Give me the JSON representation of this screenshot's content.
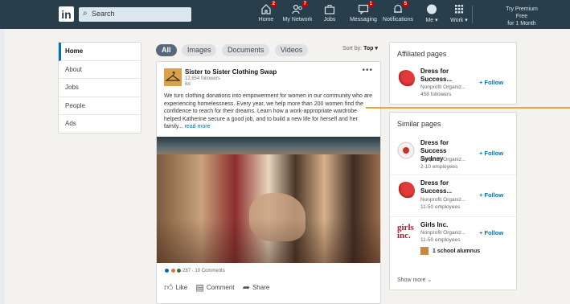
{
  "topbar": {
    "logo": "in",
    "search_placeholder": "Search",
    "nav": [
      {
        "label": "Home",
        "icon": "home-icon",
        "badge": "2"
      },
      {
        "label": "My Network",
        "icon": "network-icon",
        "badge": "7"
      },
      {
        "label": "Jobs",
        "icon": "briefcase-icon",
        "badge": ""
      },
      {
        "label": "Messaging",
        "icon": "chat-icon",
        "badge": "1"
      },
      {
        "label": "Notifications",
        "icon": "bell-icon",
        "badge": "5"
      },
      {
        "label": "Me ▾",
        "icon": "avatar-icon",
        "badge": ""
      },
      {
        "label": "Work ▾",
        "icon": "grid-icon",
        "badge": ""
      }
    ],
    "premium_line1": "Try Premium Free",
    "premium_line2": "for 1 Month"
  },
  "leftnav": [
    "Home",
    "About",
    "Jobs",
    "People",
    "Ads"
  ],
  "filters": {
    "pills": [
      "All",
      "Images",
      "Documents",
      "Videos"
    ],
    "sort_label": "Sort by:",
    "sort_value": "Top ▾"
  },
  "post": {
    "org": "Sister to Sister Clothing Swap",
    "followers": "12,654 followers",
    "age": "6d",
    "more": "•••",
    "body": "We turn clothing donations into empowerment for women in our community who are experiencing homelessness. Every year, we help more than 200 women find the confidence to reach for their dreams. Learn how a work-appropriate wardrobe helped Katherine secure a good job, and to build a new life for herself and her family...",
    "read_more": "read more",
    "reactions": "287 · 10 Comments",
    "actions": [
      "Like",
      "Comment",
      "Share"
    ]
  },
  "affiliated": {
    "title": "Affiliated pages",
    "items": [
      {
        "name": "Dress for Success...",
        "meta1": "Nonprofit Organiz...",
        "meta2": "458 followers",
        "follow": "+ Follow"
      }
    ]
  },
  "similar": {
    "title": "Similar pages",
    "items": [
      {
        "name": "Dress for Success Sydney",
        "meta1": "Nonprofit Organiz...",
        "meta2": "2-10 employees",
        "follow": "+ Follow"
      },
      {
        "name": "Dress for Success...",
        "meta1": "Nonprofit Organiz...",
        "meta2": "11-50 employees",
        "follow": "+ Follow"
      },
      {
        "name": "Girls Inc.",
        "meta1": "Nonprofit Organiz...",
        "meta2": "11-50 employees",
        "follow": "+ Follow",
        "extra": "1 school alumnus"
      }
    ],
    "show_more": "Show more ⌄"
  },
  "colors": {
    "topbar": "#283e4a",
    "accent": "#0073b1",
    "highlight_line": "#e8a73c"
  }
}
